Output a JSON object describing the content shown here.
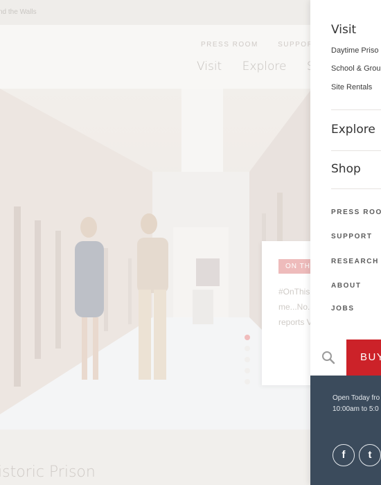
{
  "topbar": {
    "text": "nd the Walls"
  },
  "header": {
    "util_links": [
      "PRESS ROOM",
      "SUPPORT"
    ],
    "main_links": [
      "Visit",
      "Explore",
      "Sh"
    ]
  },
  "card": {
    "tag": "ON THIS",
    "lines": [
      "#OnThis",
      "me...No.",
      "reports V"
    ]
  },
  "lower": {
    "title": "istoric Prison"
  },
  "drawer": {
    "visit": {
      "heading": "Visit",
      "items": [
        "Daytime Priso",
        "School & Grou",
        "Site Rentals"
      ]
    },
    "explore": {
      "heading": "Explore"
    },
    "shop": {
      "heading": "Shop"
    },
    "util_links": [
      "PRESS ROOM",
      "SUPPORT",
      "RESEARCH",
      "ABOUT",
      "JOBS"
    ],
    "buy_label": "BUY",
    "info": {
      "line1": "Open Today fro",
      "line2": "10:00am to 5:0"
    },
    "social": [
      {
        "icon": "facebook-icon",
        "glyph": "f"
      },
      {
        "icon": "twitter-icon",
        "glyph": "t"
      }
    ],
    "colors": {
      "accent": "#cc2229",
      "info_bg": "#3b4b5c"
    }
  }
}
